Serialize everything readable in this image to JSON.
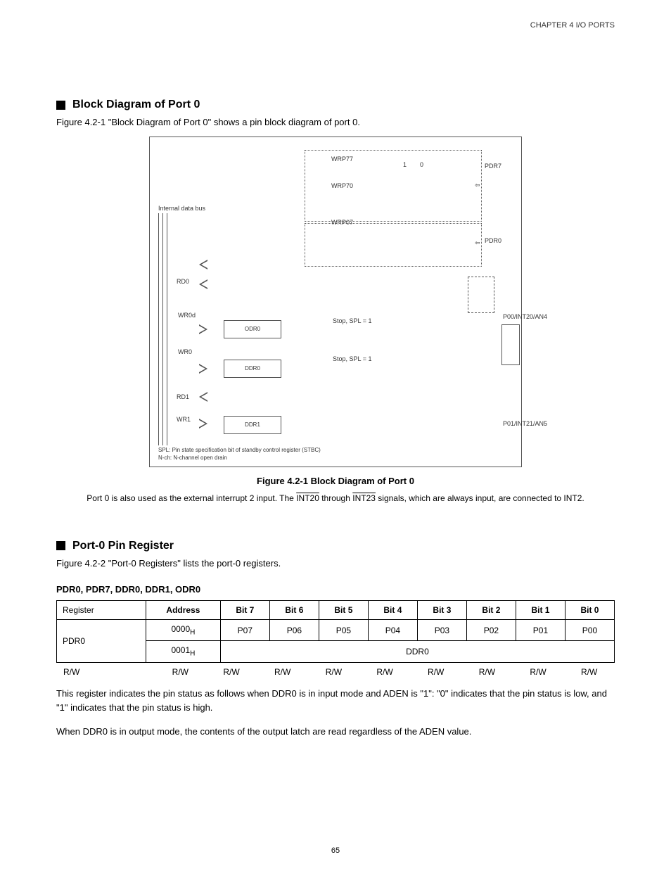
{
  "chapter_header": "CHAPTER 4  I/O PORTS",
  "section1": {
    "title": "Block Diagram of Port 0",
    "intro": "Figure 4.2-1 \"Block Diagram of Port 0\" shows a pin block diagram of port 0."
  },
  "diagram": {
    "bus_label": "Internal data bus",
    "prr7": "PDR7",
    "prr0": "PDR0",
    "wrp77": "WRP77",
    "wrp70": "WRP70",
    "wrp07": "WRP07",
    "rd0": "RD0",
    "wr0d": "WR0d",
    "wr0": "WR0",
    "rd1": "RD1",
    "wr1": "WR1",
    "odr": "ODR0",
    "ddr": "DDR0",
    "ddr1": "DDR1",
    "p00_pin": "P00/INT20/AN4",
    "p01_pin": "P01/INT21/AN5",
    "spl_1": "1",
    "spl_0": "0",
    "stop_spl1": "Stop, SPL = 1",
    "footnote": "SPL: Pin state specification bit of standby control register (STBC)\nN-ch: N-channel open drain"
  },
  "figure_caption": "Figure 4.2-1  Block Diagram of Port 0",
  "figure_note_prefix": "Port 0 is also used as the external interrupt 2 input. The ",
  "figure_note_int20": "INT20",
  "figure_note_mid": " through ",
  "figure_note_int23": "INT23",
  "figure_note_suffix": " signals, which are always input, are connected to INT2.",
  "section2": {
    "title": "Port-0 Pin Register",
    "intro": "Figure 4.2-2 \"Port-0 Registers\" lists the port-0 registers."
  },
  "table_label": "PDR0, PDR7, DDR0, DDR1, ODR0",
  "table": {
    "h_register": "Register",
    "h_addr": "Address",
    "h_bit7": "Bit 7",
    "h_bit6": "Bit 6",
    "h_bit5": "Bit 5",
    "h_bit4": "Bit 4",
    "h_bit3": "Bit 3",
    "h_bit2": "Bit 2",
    "h_bit1": "Bit 1",
    "h_bit0": "Bit 0",
    "r_pdr0": "PDR0",
    "r_pdr0_addr": "0000H",
    "c_p07": "P07",
    "c_p06": "P06",
    "c_p05": "P05",
    "c_p04": "P04",
    "c_p03": "P03",
    "c_p02": "P02",
    "c_p01": "P01",
    "c_p00": "P00",
    "r_ddr0": "DDR0",
    "r_ddr0_addr": "0001H"
  },
  "rw": {
    "label": "R/W",
    "v": "R/W"
  },
  "desc1": "This register indicates the pin status as follows when DDR0 is in input mode and ADEN is \"1\": \"0\" indicates that the pin status is low, and \"1\" indicates that the pin status is high.",
  "desc2": "When DDR0 is in output mode, the contents of the output latch are read regardless of the ADEN value.",
  "page_number": "65"
}
